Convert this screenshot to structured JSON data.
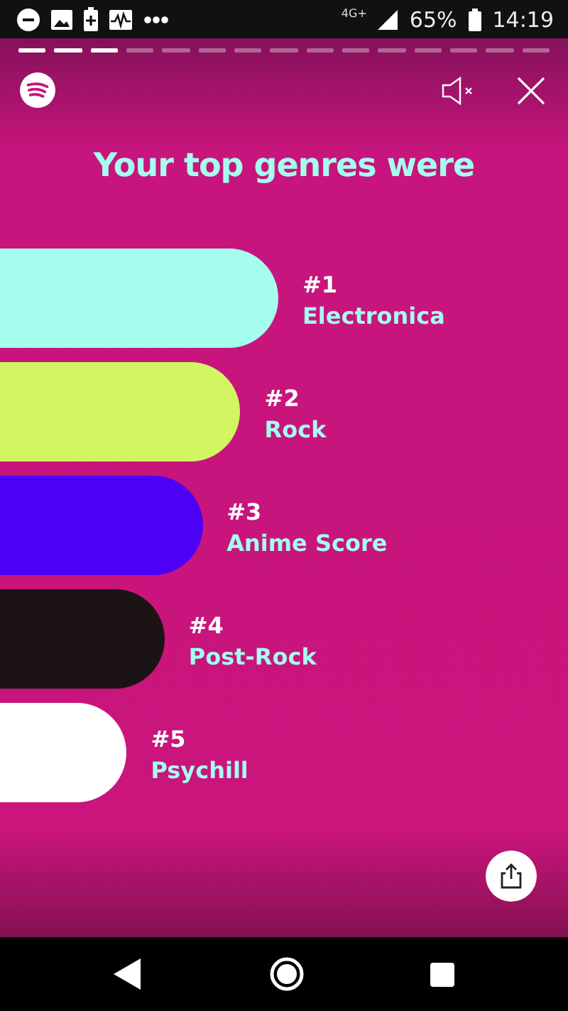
{
  "status_bar": {
    "network": "4G+",
    "battery": "65%",
    "time": "14:19"
  },
  "progress": [
    {
      "done": true
    },
    {
      "done": true
    },
    {
      "done": true
    },
    {
      "done": false
    },
    {
      "done": false
    },
    {
      "done": false
    },
    {
      "done": false
    },
    {
      "done": false
    },
    {
      "done": false
    },
    {
      "done": false
    },
    {
      "done": false
    },
    {
      "done": false
    },
    {
      "done": false
    },
    {
      "done": false
    },
    {
      "done": false
    }
  ],
  "title": "Your top genres were",
  "genres": [
    {
      "rank": "#1",
      "name": "Electronica",
      "color": "#a5fdee"
    },
    {
      "rank": "#2",
      "name": "Rock",
      "color": "#d2f562"
    },
    {
      "rank": "#3",
      "name": "Anime Score",
      "color": "#4c00f5"
    },
    {
      "rank": "#4",
      "name": "Post-Rock",
      "color": "#1c1414"
    },
    {
      "rank": "#5",
      "name": "Psychill",
      "color": "#ffffff"
    }
  ]
}
